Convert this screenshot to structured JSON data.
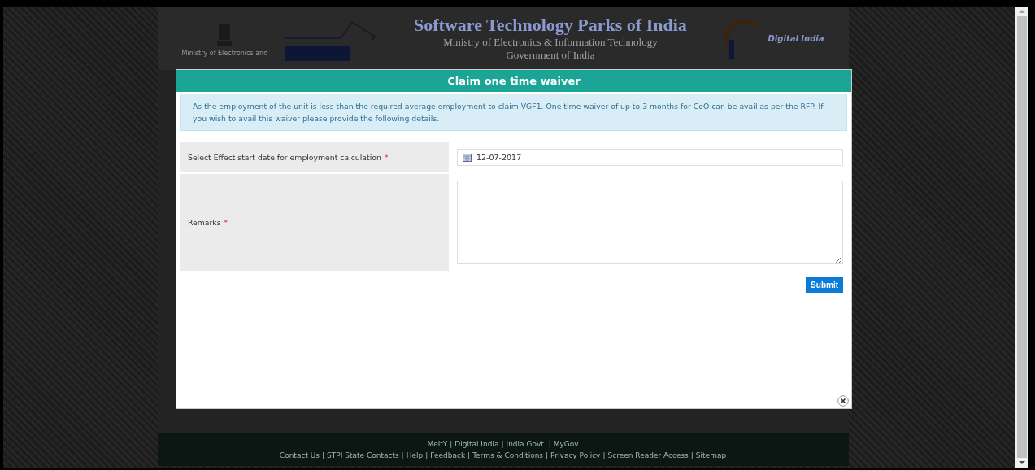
{
  "background_page": {
    "header": {
      "emblem_caption": "Ministry of Electronics and",
      "title": "Software Technology Parks of India",
      "subtitle": "Ministry of Electronics & Information Technology",
      "government": "Government of India",
      "digital_india": "Digital India"
    },
    "footer": {
      "separator": "|",
      "primary_links": [
        "MeitY",
        "Digital India",
        "India Govt.",
        "MyGov"
      ],
      "secondary_links": [
        "Contact Us",
        "STPI State Contacts",
        "Help",
        "Feedback",
        "Terms & Conditions",
        "Privacy Policy",
        "Screen Reader Access",
        "Sitemap"
      ]
    }
  },
  "modal": {
    "title": "Claim one time waiver",
    "message": "As the employment of the unit is less than the required average employment to claim VGF1. One time waiver of up to 3 months for CoO can be avail as per the RFP. If you wish to avail this waiver please provide the following details.",
    "fields": [
      {
        "kind": "date",
        "label": "Select Effect start date for employment calculation",
        "required_mark": "*",
        "value": "12-07-2017"
      },
      {
        "kind": "textarea",
        "label": "Remarks",
        "required_mark": "*"
      }
    ],
    "submit_button": "Submit"
  }
}
